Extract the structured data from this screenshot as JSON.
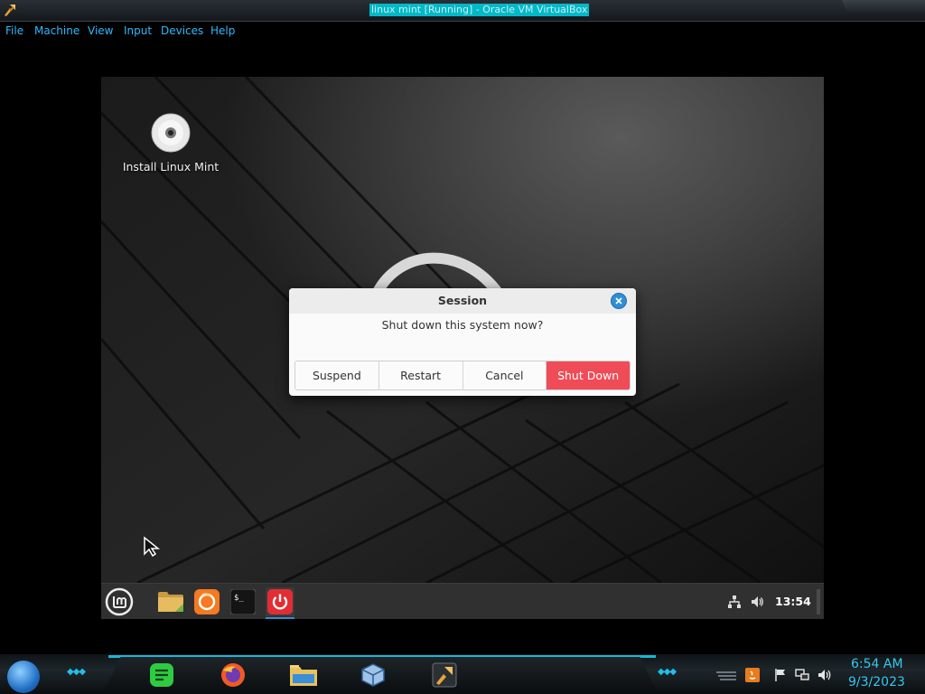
{
  "host_window": {
    "title": "linux mint [Running] - Oracle VM VirtualBox"
  },
  "menubar": {
    "items": [
      "File",
      "Machine",
      "View",
      "Input",
      "Devices",
      "Help"
    ]
  },
  "desktop": {
    "icon_label": "Install Linux Mint"
  },
  "dialog": {
    "title": "Session",
    "message": "Shut down this system now?",
    "buttons": {
      "suspend": "Suspend",
      "restart": "Restart",
      "cancel": "Cancel",
      "shutdown": "Shut Down"
    }
  },
  "panel": {
    "clock": "13:54",
    "launchers": [
      "mint-menu-icon",
      "files-icon",
      "firefox-icon",
      "terminal-icon",
      "power-icon"
    ],
    "tray": [
      "network-icon",
      "volume-icon"
    ]
  },
  "host_taskbar": {
    "time": "6:54 AM",
    "date": "9/3/2023"
  },
  "colors": {
    "accent_blue": "#2f8fd5",
    "shutdown_red": "#ef4c57",
    "menu_text": "#2db9ff",
    "host_clock": "#36c8ee"
  }
}
